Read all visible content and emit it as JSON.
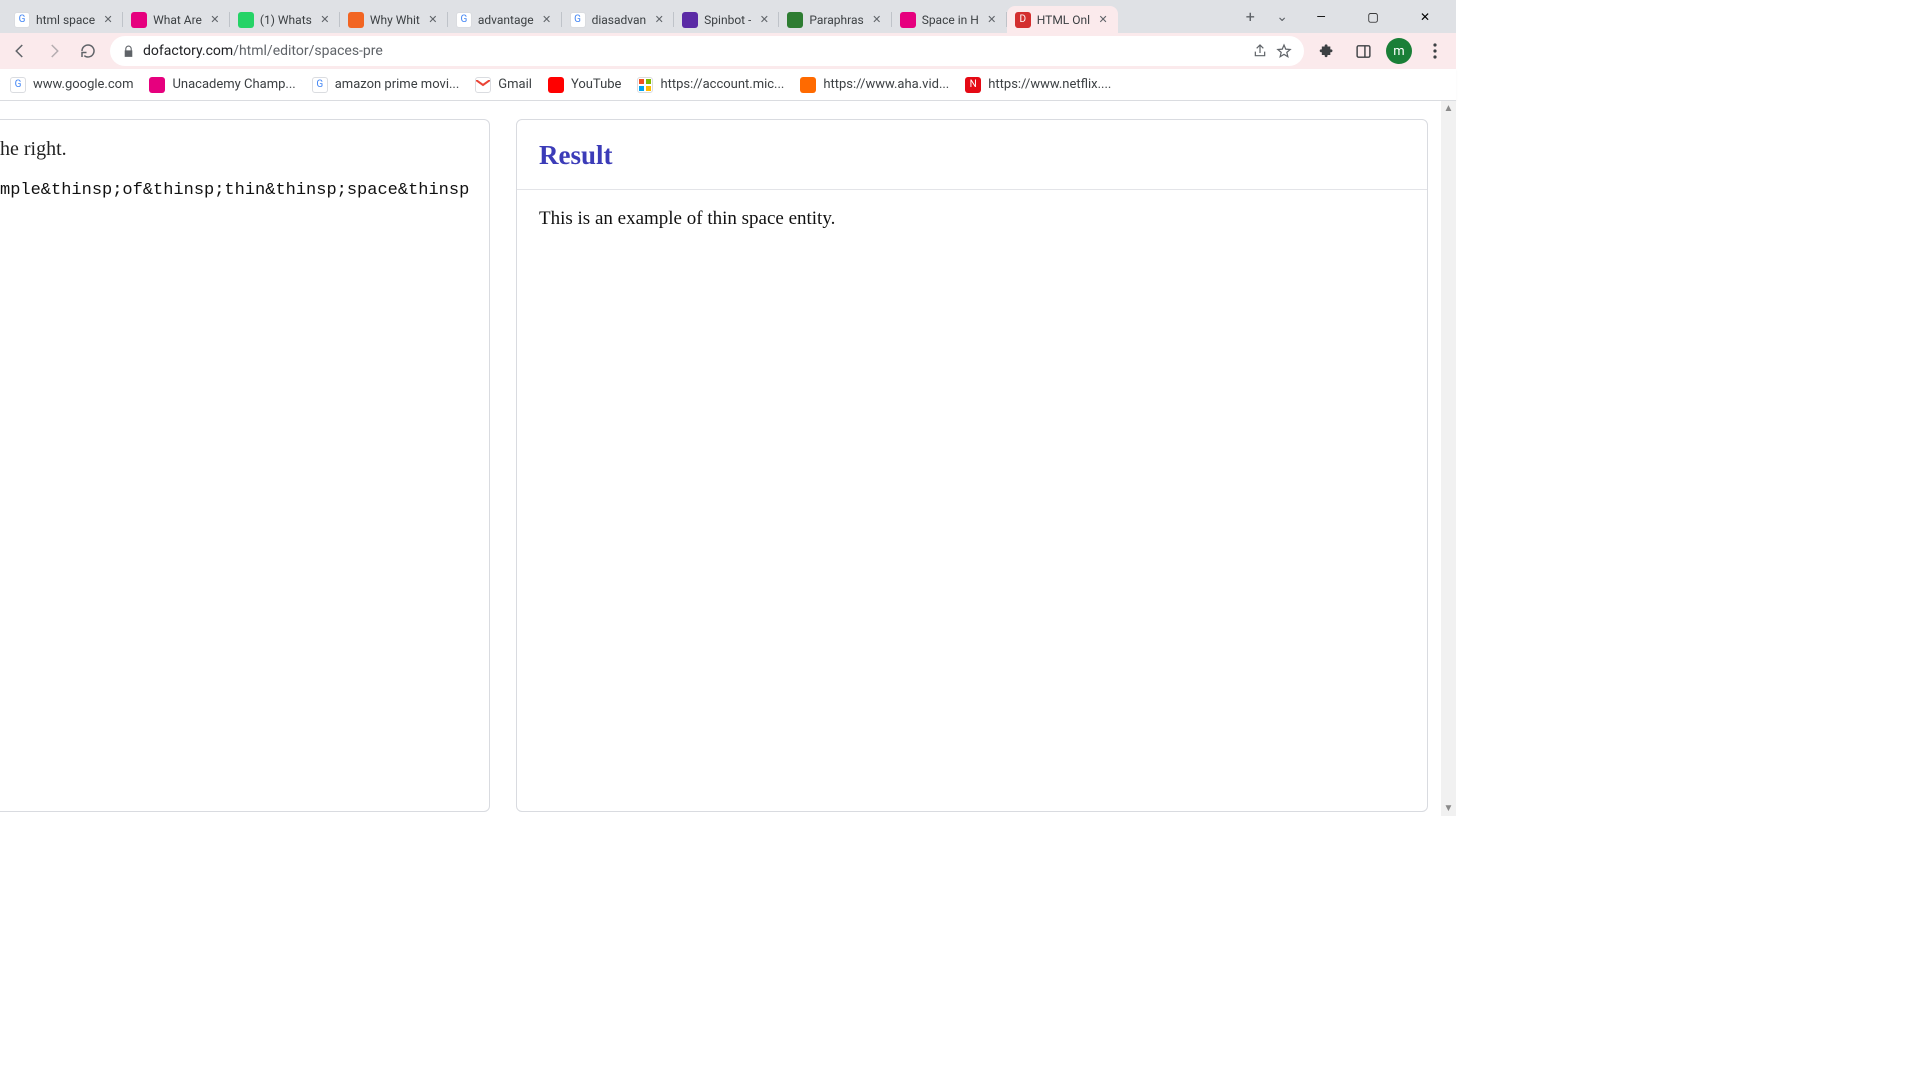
{
  "tabs": [
    {
      "title": "html space",
      "fav_bg": "#ffffff",
      "fav_text": "G",
      "fav_color": "#4285f4",
      "active": false
    },
    {
      "title": "What Are",
      "fav_bg": "#e6007e",
      "fav_text": "",
      "active": false
    },
    {
      "title": "(1) Whats",
      "fav_bg": "#25d366",
      "fav_text": "",
      "active": false
    },
    {
      "title": "Why Whit",
      "fav_bg": "#f26522",
      "fav_text": "",
      "active": false
    },
    {
      "title": "advantage",
      "fav_bg": "#ffffff",
      "fav_text": "G",
      "fav_color": "#4285f4",
      "active": false
    },
    {
      "title": "diasadvan",
      "fav_bg": "#ffffff",
      "fav_text": "G",
      "fav_color": "#4285f4",
      "active": false
    },
    {
      "title": "Spinbot -",
      "fav_bg": "#5b2aa5",
      "fav_text": "",
      "active": false
    },
    {
      "title": "Paraphras",
      "fav_bg": "#2e7d32",
      "fav_text": "",
      "active": false
    },
    {
      "title": "Space in H",
      "fav_bg": "#e6007e",
      "fav_text": "",
      "active": false
    },
    {
      "title": "HTML Onl",
      "fav_bg": "#d32f2f",
      "fav_text": "D",
      "active": true
    }
  ],
  "window_controls": {
    "min": "—",
    "max": "▢",
    "close": "✕"
  },
  "tabstrip_chevron": "⌄",
  "newtab": "+",
  "toolbar": {
    "back": "←",
    "forward": "→",
    "reload": "⟳",
    "lock": "🔒",
    "url_host": "dofactory.com",
    "url_path": "/html/editor/spaces-pre",
    "share": "⇧",
    "star": "☆",
    "ext": "✦",
    "panel": "▣",
    "menu": "⋮",
    "avatar": "m"
  },
  "bookmarks": [
    {
      "title": "www.google.com",
      "fav_bg": "#ffffff",
      "fav_text": "G",
      "fav_color": "#4285f4"
    },
    {
      "title": "Unacademy Champ...",
      "fav_bg": "#e6007e",
      "fav_text": ""
    },
    {
      "title": "amazon prime movi...",
      "fav_bg": "#ffffff",
      "fav_text": "G",
      "fav_color": "#4285f4"
    },
    {
      "title": "Gmail",
      "fav_bg": "#ea4335",
      "fav_text": "",
      "special": "gmail"
    },
    {
      "title": "YouTube",
      "fav_bg": "#ff0000",
      "fav_text": ""
    },
    {
      "title": "https://account.mic...",
      "fav_bg": "#ffffff",
      "fav_text": "",
      "special": "ms"
    },
    {
      "title": "https://www.aha.vid...",
      "fav_bg": "#ff6a00",
      "fav_text": ""
    },
    {
      "title": "https://www.netflix....",
      "fav_bg": "#e50914",
      "fav_text": "N"
    }
  ],
  "editor": {
    "hint_fragment": "he right.",
    "code_fragment": "mple&thinsp;of&thinsp;thin&thinsp;space&thinsp"
  },
  "result": {
    "heading": "Result",
    "body": "This is an example of thin space entity."
  }
}
